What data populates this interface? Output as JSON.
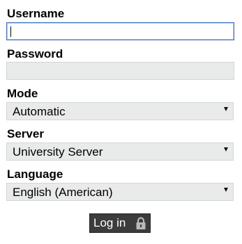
{
  "username": {
    "label": "Username",
    "value": ""
  },
  "password": {
    "label": "Password",
    "value": ""
  },
  "mode": {
    "label": "Mode",
    "selected": "Automatic"
  },
  "server": {
    "label": "Server",
    "selected": "University Server"
  },
  "language": {
    "label": "Language",
    "selected": "English (American)"
  },
  "login_button": {
    "label": "Log in",
    "icon": "lock-icon"
  },
  "colors": {
    "field_background": "#e9ebea",
    "active_border": "#3d6fc0",
    "button_background": "#3d3b3c"
  }
}
